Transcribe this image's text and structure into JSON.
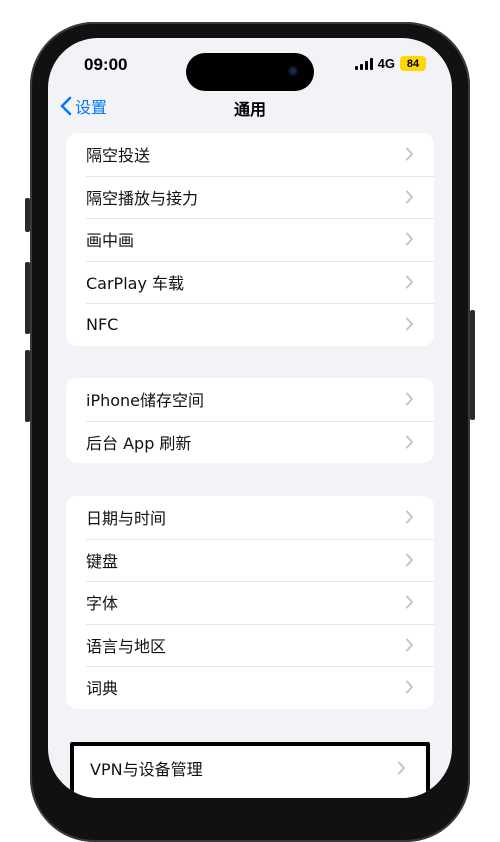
{
  "status_bar": {
    "time": "09:00",
    "network": "4G",
    "battery": "84"
  },
  "nav": {
    "back_label": "设置",
    "title": "通用"
  },
  "groups": [
    {
      "items": [
        {
          "label": "隔空投送"
        },
        {
          "label": "隔空播放与接力"
        },
        {
          "label": "画中画"
        },
        {
          "label": "CarPlay 车载"
        },
        {
          "label": "NFC"
        }
      ]
    },
    {
      "items": [
        {
          "label": "iPhone储存空间"
        },
        {
          "label": "后台 App 刷新"
        }
      ]
    },
    {
      "items": [
        {
          "label": "日期与时间"
        },
        {
          "label": "键盘"
        },
        {
          "label": "字体"
        },
        {
          "label": "语言与地区"
        },
        {
          "label": "词典"
        }
      ]
    }
  ],
  "highlighted_item": {
    "label": "VPN与设备管理"
  },
  "colors": {
    "accent": "#007aff",
    "battery": "#ffd60a",
    "background": "#f2f2f7"
  }
}
